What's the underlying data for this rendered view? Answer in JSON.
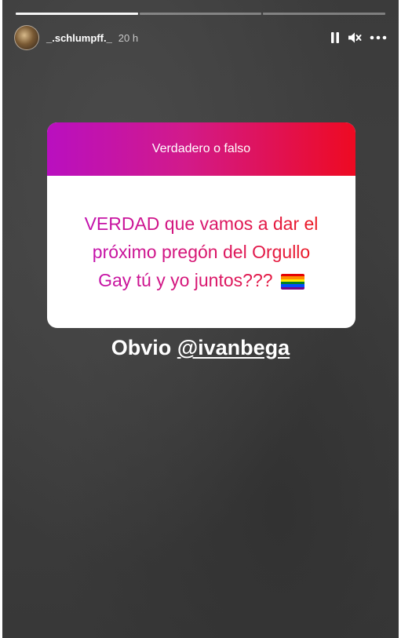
{
  "story": {
    "progress_total": 3,
    "progress_done": 1,
    "username": "_.schlumpff._",
    "time": "20 h",
    "icons": [
      "pause-icon",
      "mute-icon",
      "more-icon"
    ]
  },
  "question_card": {
    "title": "Verdadero o falso",
    "question": "VERDAD que vamos a dar el próximo pregón del Orgullo Gay tú y yo juntos???",
    "emoji": "rainbow-flag-icon",
    "gradient_colors": [
      "#b90fc0",
      "#ee0a22"
    ]
  },
  "answer": {
    "text": "Obvio ",
    "mention": "@ivanbega"
  }
}
